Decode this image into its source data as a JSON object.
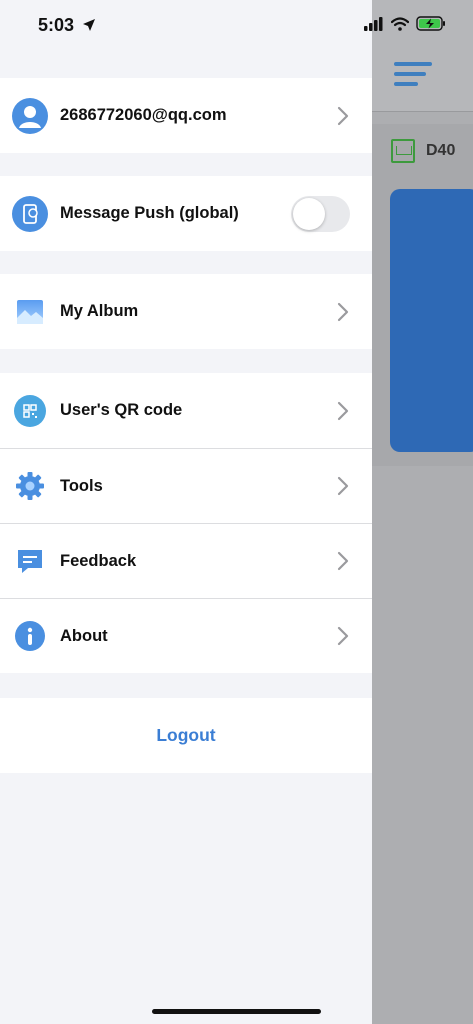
{
  "status_bar": {
    "time": "5:03"
  },
  "background_app": {
    "device_label": "D40"
  },
  "drawer": {
    "account": {
      "email": "2686772060@qq.com"
    },
    "message_push": {
      "label": "Message Push (global)",
      "enabled": false
    },
    "album": {
      "label": "My Album"
    },
    "menu": [
      {
        "label": "User's QR code",
        "icon": "qr-code-icon"
      },
      {
        "label": "Tools",
        "icon": "gear-icon"
      },
      {
        "label": "Feedback",
        "icon": "feedback-icon"
      },
      {
        "label": "About",
        "icon": "info-icon"
      }
    ],
    "logout_label": "Logout"
  },
  "colors": {
    "accent": "#3b7ed4",
    "icon_blue": "#4a8fe0",
    "toggle_off": "#e8e9ec"
  }
}
